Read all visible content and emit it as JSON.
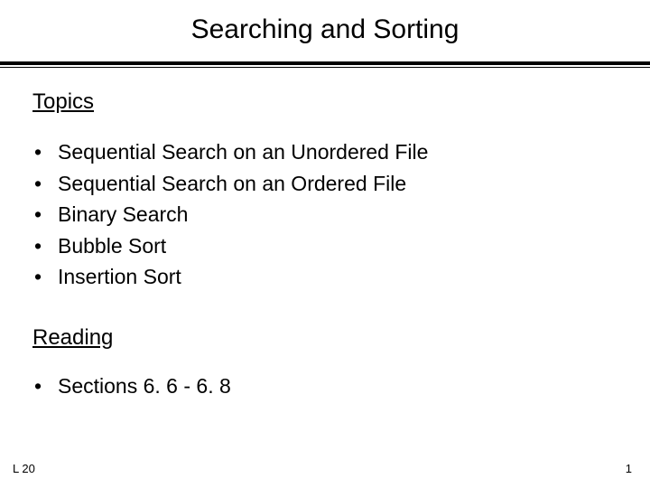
{
  "title": "Searching and Sorting",
  "sections": {
    "topics": {
      "heading": "Topics",
      "items": [
        "Sequential Search on an Unordered File",
        "Sequential Search on an Ordered File",
        "Binary Search",
        "Bubble Sort",
        "Insertion Sort"
      ]
    },
    "reading": {
      "heading": "Reading",
      "items": [
        "Sections 6. 6 - 6. 8"
      ]
    }
  },
  "footer": {
    "left": "L 20",
    "right": "1"
  }
}
